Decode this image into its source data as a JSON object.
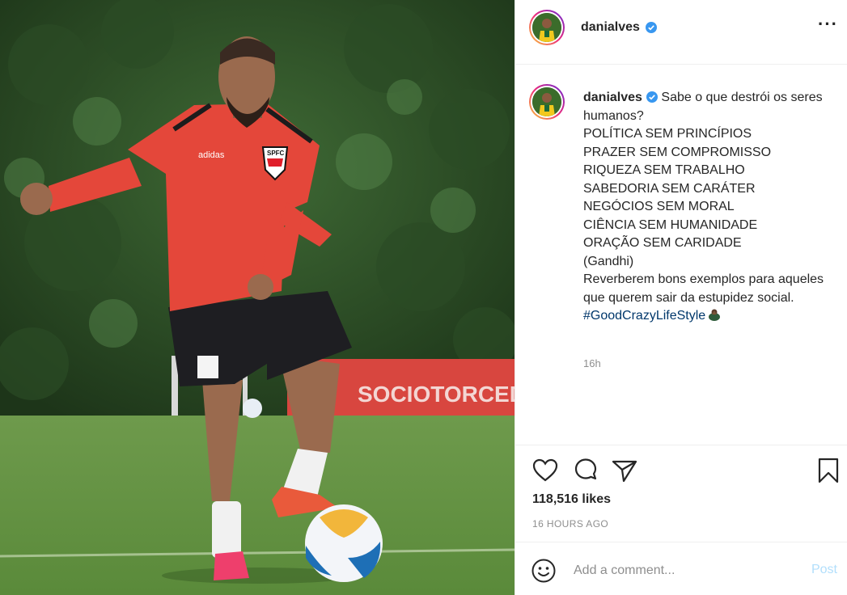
{
  "photo": {
    "subject": "player-juggling-ball",
    "banner_text": "SOCIOTORCEDO",
    "shirt_badge": "SPFC"
  },
  "header": {
    "username": "danialves",
    "verified": true,
    "more_icon": "more-horizontal-icon"
  },
  "caption": {
    "username": "danialves",
    "first_line": "Sabe o que destrói os seres humanos?",
    "lines": [
      "POLÍTICA SEM PRINCÍPIOS",
      "PRAZER SEM COMPROMISSO",
      "RIQUEZA SEM TRABALHO",
      "SABEDORIA SEM CARÁTER",
      "NEGÓCIOS SEM MORAL",
      "CIÊNCIA SEM HUMANIDADE",
      "ORAÇÃO SEM CARIDADE",
      "(Gandhi)",
      "Reverberem bons exemplos para aqueles que querem sair da estupidez social."
    ],
    "hashtag": "#GoodCrazyLifeStyle",
    "time_ago": "16h"
  },
  "actions": {
    "like_icon": "heart-icon",
    "comment_icon": "comment-icon",
    "share_icon": "paper-plane-icon",
    "save_icon": "bookmark-icon",
    "likes": "118,516 likes",
    "posted": "16 HOURS AGO"
  },
  "comment_bar": {
    "emoji_icon": "smiley-icon",
    "placeholder": "Add a comment...",
    "post_label": "Post"
  },
  "colors": {
    "link": "#00376b",
    "muted": "#8e8e8e",
    "post_disabled": "#b2dffc",
    "verified": "#3897f0"
  }
}
